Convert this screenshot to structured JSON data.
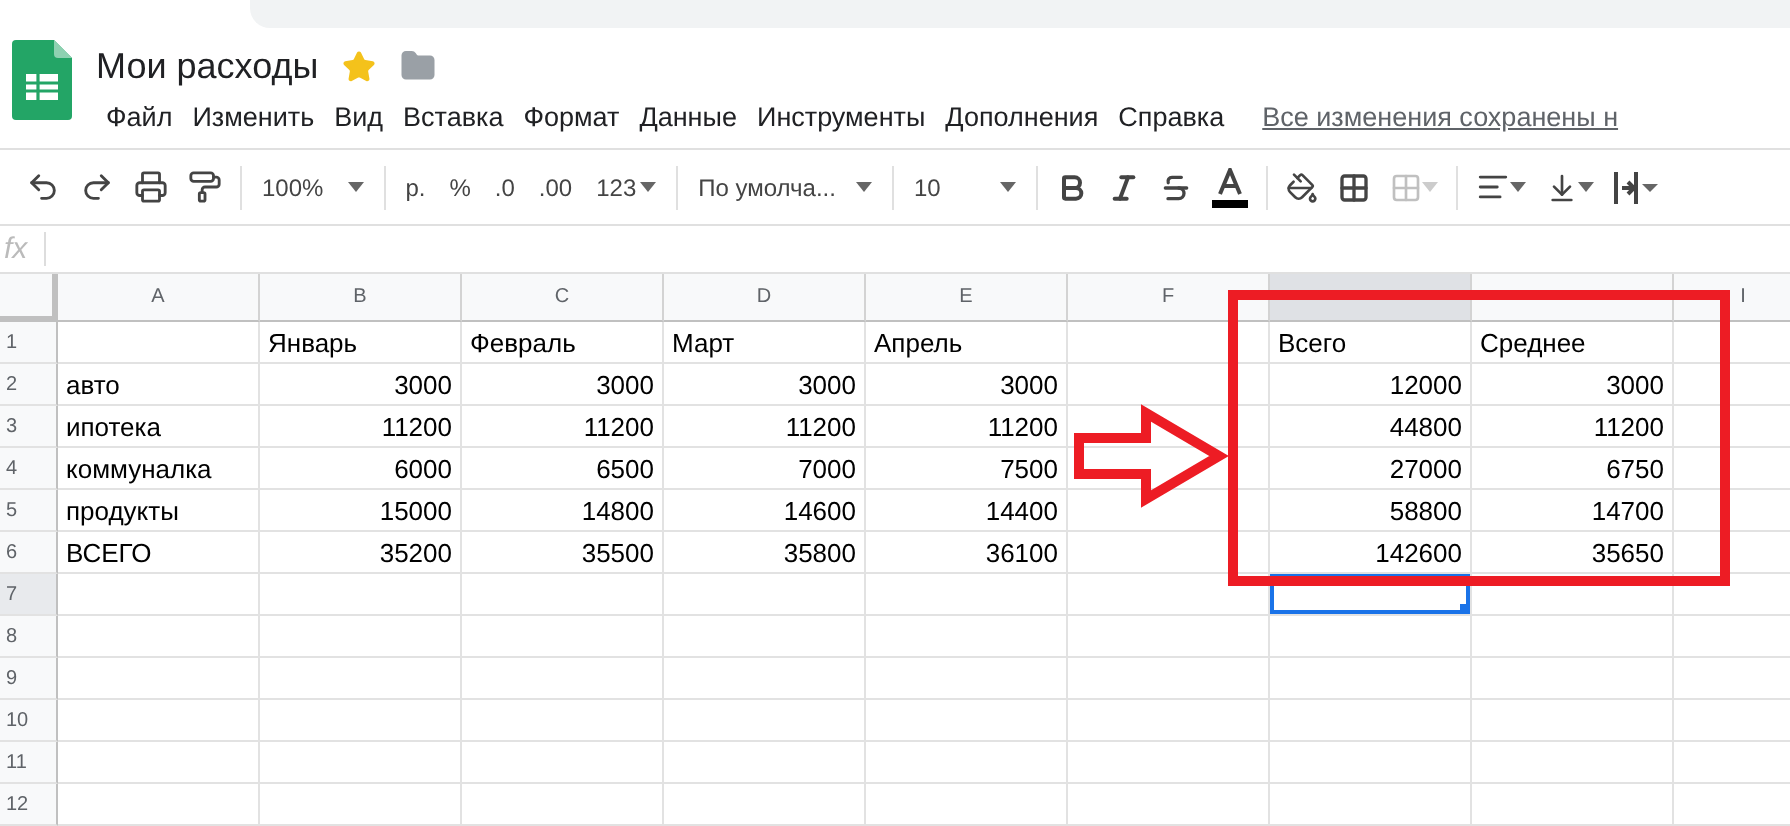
{
  "document": {
    "title": "Мои расходы",
    "starred": true
  },
  "menu": [
    "Файл",
    "Изменить",
    "Вид",
    "Вставка",
    "Формат",
    "Данные",
    "Инструменты",
    "Дополнения",
    "Справка"
  ],
  "save_status": "Все изменения сохранены н",
  "toolbar": {
    "zoom": "100%",
    "currency": "р.",
    "percent": "%",
    "decrease_decimals": ".0",
    "increase_decimals": ".00",
    "number_format": "123",
    "font": "По умолча...",
    "font_size": "10"
  },
  "formula_bar": {
    "label": "fx"
  },
  "sheet": {
    "columns": [
      {
        "label": "A",
        "selected": false
      },
      {
        "label": "B",
        "selected": false
      },
      {
        "label": "C",
        "selected": false
      },
      {
        "label": "D",
        "selected": false
      },
      {
        "label": "E",
        "selected": false
      },
      {
        "label": "F",
        "selected": false
      },
      {
        "selected": true
      },
      {
        "selected": false
      },
      {
        "label": "I",
        "selected": false
      }
    ],
    "rows": [
      {
        "number": "1",
        "selected": false,
        "kind": "labels",
        "cells": [
          null,
          "Январь",
          "Февраль",
          "Март",
          "Апрель",
          null,
          "Всего",
          "Среднее",
          null
        ]
      },
      {
        "number": "2",
        "selected": false,
        "kind": "values",
        "cells": [
          "авто",
          "3000",
          "3000",
          "3000",
          "3000",
          null,
          "12000",
          "3000",
          null
        ]
      },
      {
        "number": "3",
        "selected": false,
        "kind": "values",
        "cells": [
          "ипотека",
          "11200",
          "11200",
          "11200",
          "11200",
          null,
          "44800",
          "11200",
          null
        ]
      },
      {
        "number": "4",
        "selected": false,
        "kind": "values",
        "cells": [
          "коммуналка",
          "6000",
          "6500",
          "7000",
          "7500",
          null,
          "27000",
          "6750",
          null
        ]
      },
      {
        "number": "5",
        "selected": false,
        "kind": "values",
        "cells": [
          "продукты",
          "15000",
          "14800",
          "14600",
          "14400",
          null,
          "58800",
          "14700",
          null
        ]
      },
      {
        "number": "6",
        "selected": false,
        "kind": "values",
        "cells": [
          "ВСЕГО",
          "35200",
          "35500",
          "35800",
          "36100",
          null,
          "142600",
          "35650",
          null
        ]
      },
      {
        "number": "7",
        "selected": true,
        "kind": "values",
        "cells": [
          null,
          null,
          null,
          null,
          null,
          null,
          null,
          null,
          null
        ]
      },
      {
        "number": "8",
        "selected": false,
        "kind": "values",
        "cells": [
          null,
          null,
          null,
          null,
          null,
          null,
          null,
          null,
          null
        ]
      },
      {
        "number": "9",
        "selected": false,
        "kind": "values",
        "cells": [
          null,
          null,
          null,
          null,
          null,
          null,
          null,
          null,
          null
        ]
      },
      {
        "number": "10",
        "selected": false,
        "kind": "values",
        "cells": [
          null,
          null,
          null,
          null,
          null,
          null,
          null,
          null,
          null
        ]
      },
      {
        "number": "11",
        "selected": false,
        "kind": "values",
        "cells": [
          null,
          null,
          null,
          null,
          null,
          null,
          null,
          null,
          null
        ]
      },
      {
        "number": "12",
        "selected": false,
        "kind": "values",
        "cells": [
          null,
          null,
          null,
          null,
          null,
          null,
          null,
          null,
          null
        ]
      }
    ]
  },
  "annotations": [
    {
      "kind": "arrow"
    },
    {
      "kind": "frame"
    }
  ]
}
